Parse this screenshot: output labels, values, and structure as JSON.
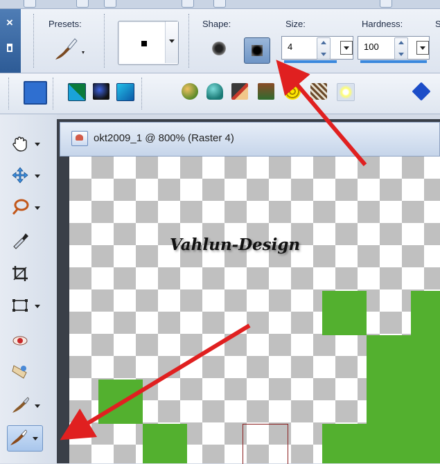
{
  "options_bar": {
    "presets_label": "Presets:",
    "shape_label": "Shape:",
    "size_label": "Size:",
    "size_value": "4",
    "hardness_label": "Hardness:",
    "hardness_value": "100",
    "next_label_partial": "S"
  },
  "document": {
    "title": "okt2009_1 @ 800% (Raster 4)"
  },
  "watermark": "Vahlun-Design",
  "colors": {
    "canvas_green": "#53b02f",
    "checker_gray": "#c0c0c0",
    "arrow_red": "#e02020"
  },
  "tools": [
    {
      "name": "pan-tool",
      "icon": "hand-icon"
    },
    {
      "name": "move-tool",
      "icon": "move-arrows-icon"
    },
    {
      "name": "lasso-tool",
      "icon": "lasso-icon"
    },
    {
      "name": "dropper-tool",
      "icon": "eyedropper-icon"
    },
    {
      "name": "crop-tool",
      "icon": "crop-icon"
    },
    {
      "name": "deform-tool",
      "icon": "pick-icon"
    },
    {
      "name": "red-eye-tool",
      "icon": "eye-icon"
    },
    {
      "name": "makeover-tool",
      "icon": "bandage-icon"
    },
    {
      "name": "clone-brush-tool",
      "icon": "clone-brush-icon"
    },
    {
      "name": "paint-brush-tool",
      "icon": "paintbrush-icon"
    }
  ]
}
